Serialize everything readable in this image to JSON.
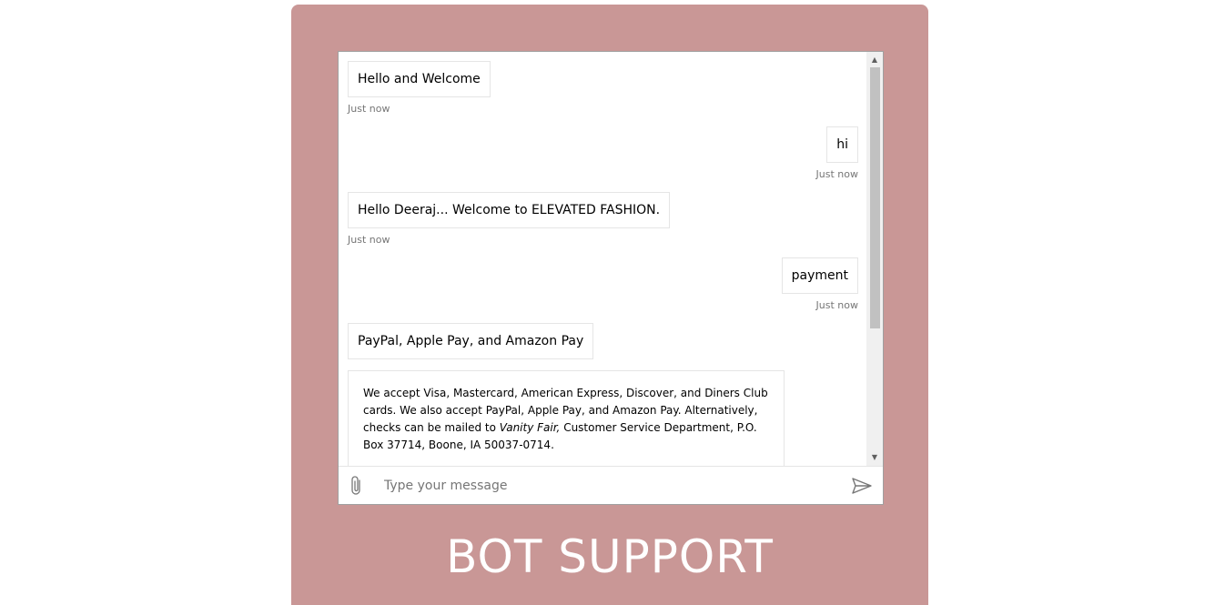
{
  "banner": {
    "title": "BOT SUPPORT"
  },
  "messages": [
    {
      "from": "bot",
      "text": "Hello and Welcome",
      "timestamp": "Just now"
    },
    {
      "from": "user",
      "text": "hi",
      "timestamp": "Just now"
    },
    {
      "from": "bot",
      "text": "Hello Deeraj... Welcome to ELEVATED FASHION.",
      "timestamp": "Just now"
    },
    {
      "from": "user",
      "text": "payment",
      "timestamp": "Just now"
    },
    {
      "from": "bot",
      "text": "PayPal, Apple Pay, and Amazon Pay",
      "timestamp": ""
    }
  ],
  "card": {
    "text_before": "We accept Visa, Mastercard, American Express, Discover, and Diners Club cards. We also accept PayPal, Apple Pay, and Amazon Pay. Alternatively, checks can be mailed to ",
    "italic": "Vanity Fair,",
    "text_after": " Customer Service Department, P.O. Box 37714, Boone, IA 50037-0714."
  },
  "input": {
    "placeholder": "Type your message",
    "value": ""
  },
  "icons": {
    "attach": "paperclip-icon",
    "send": "send-icon"
  },
  "colors": {
    "frame": "#c99796",
    "banner_text": "#ffffff"
  }
}
